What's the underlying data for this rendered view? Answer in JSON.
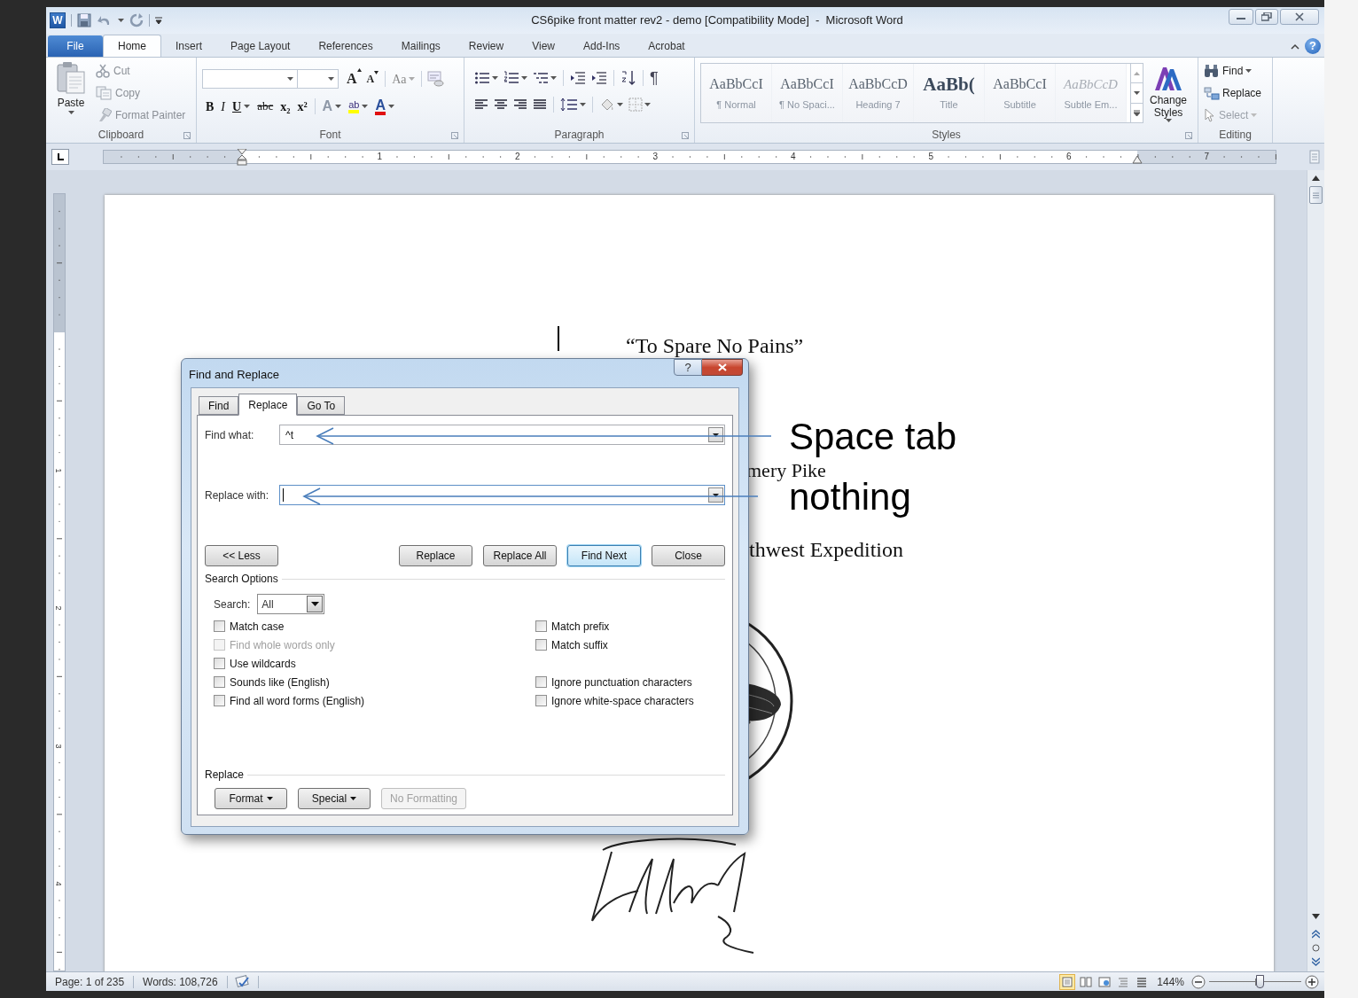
{
  "window": {
    "app_icon": "W",
    "title": "CS6pike front matter rev2 - demo [Compatibility Mode]  -  Microsoft Word",
    "help": "?"
  },
  "tabs": [
    {
      "label": "File",
      "kind": "file",
      "selected": false
    },
    {
      "label": "Home",
      "kind": "tab",
      "selected": true
    },
    {
      "label": "Insert",
      "kind": "tab",
      "selected": false
    },
    {
      "label": "Page Layout",
      "kind": "tab",
      "selected": false
    },
    {
      "label": "References",
      "kind": "tab",
      "selected": false
    },
    {
      "label": "Mailings",
      "kind": "tab",
      "selected": false
    },
    {
      "label": "Review",
      "kind": "tab",
      "selected": false
    },
    {
      "label": "View",
      "kind": "tab",
      "selected": false
    },
    {
      "label": "Add-Ins",
      "kind": "tab",
      "selected": false
    },
    {
      "label": "Acrobat",
      "kind": "tab",
      "selected": false
    }
  ],
  "clipboard": {
    "label": "Clipboard",
    "paste": "Paste",
    "items": [
      {
        "label": "Cut",
        "kind": "cut",
        "disabled": true
      },
      {
        "label": "Copy",
        "kind": "copy",
        "disabled": true
      },
      {
        "label": "Format Painter",
        "kind": "painter",
        "disabled": true
      }
    ]
  },
  "font": {
    "label": "Font",
    "row1": [
      {
        "text": "A",
        "kind": "grow"
      },
      {
        "text": "A",
        "kind": "shrink"
      },
      {
        "text": "Aa",
        "kind": "case",
        "menu": true
      }
    ],
    "row2": [
      {
        "text": "B",
        "kind": "bold",
        "menu": false
      },
      {
        "text": "I",
        "kind": "italic",
        "menu": false
      },
      {
        "text": "U",
        "kind": "underline",
        "menu": true
      },
      {
        "text": "abc",
        "kind": "strike",
        "menu": false
      },
      {
        "text": "x₂",
        "kind": "sub",
        "menu": false
      },
      {
        "text": "x²",
        "kind": "sup",
        "menu": false
      },
      {
        "text": "A",
        "kind": "effects",
        "menu": true
      },
      {
        "text": "ab",
        "kind": "highlight",
        "menu": true
      },
      {
        "text": "A",
        "kind": "color",
        "menu": true
      }
    ]
  },
  "paragraph": {
    "label": "Paragraph",
    "pilcrow": "¶"
  },
  "styles": {
    "label": "Styles",
    "change_styles": "Change Styles",
    "gallery": [
      {
        "preview": "AaBbCcI",
        "name": "¶ Normal",
        "kind": "normal"
      },
      {
        "preview": "AaBbCcI",
        "name": "¶ No Spaci...",
        "kind": "normal"
      },
      {
        "preview": "AaBbCcD",
        "name": "Heading 7",
        "kind": "normal"
      },
      {
        "preview": "AaBb(",
        "name": "Title",
        "kind": "title"
      },
      {
        "preview": "AaBbCcI",
        "name": "Subtitle",
        "kind": "normal"
      },
      {
        "preview": "AaBbCcD",
        "name": "Subtle Em...",
        "kind": "emphasis"
      }
    ]
  },
  "editing": {
    "label": "Editing",
    "items": [
      {
        "label": "Find",
        "kind": "find",
        "menu": true,
        "disabled": false
      },
      {
        "label": "Replace",
        "kind": "replace",
        "menu": false,
        "disabled": false
      },
      {
        "label": "Select",
        "kind": "select",
        "menu": true,
        "disabled": true
      }
    ]
  },
  "ruler": {
    "numbers": [
      "1",
      "2",
      "3",
      "4",
      "5",
      "6",
      "7"
    ]
  },
  "vertical_ruler": {
    "numbers": [
      "1",
      "2",
      "3",
      "4"
    ]
  },
  "page": {
    "title": "“To Spare No Pains”",
    "line_2": "mery Pike",
    "line_3": "thwest Expedition"
  },
  "dialog": {
    "title": "Find and Replace",
    "help": "?",
    "tabs": [
      {
        "label": "Find",
        "selected": false
      },
      {
        "label": "Replace",
        "selected": true
      },
      {
        "label": "Go To",
        "selected": false
      }
    ],
    "find_what": {
      "label": "Find what:",
      "value": "^t"
    },
    "replace_with": {
      "label": "Replace with:",
      "focused": true
    },
    "buttons": [
      {
        "label": "<< Less",
        "kind": "toggle",
        "default": false
      },
      {
        "label": "Replace",
        "kind": "action",
        "default": false
      },
      {
        "label": "Replace All",
        "kind": "action",
        "default": false
      },
      {
        "label": "Find Next",
        "kind": "action",
        "default": true
      },
      {
        "label": "Close",
        "kind": "action",
        "default": false
      }
    ],
    "search_options": {
      "label": "Search Options",
      "search_label": "Search:",
      "search_value": "All",
      "left": [
        {
          "label": "Match case",
          "checked": false,
          "disabled": false
        },
        {
          "label": "Find whole words only",
          "checked": false,
          "disabled": true
        },
        {
          "label": "Use wildcards",
          "checked": false,
          "disabled": false
        },
        {
          "label": "Sounds like (English)",
          "checked": false,
          "disabled": false
        },
        {
          "label": "Find all word forms (English)",
          "checked": false,
          "disabled": false
        }
      ],
      "right_upper": [
        {
          "label": "Match prefix",
          "checked": false,
          "disabled": false
        },
        {
          "label": "Match suffix",
          "checked": false,
          "disabled": false
        }
      ],
      "right_lower": [
        {
          "label": "Ignore punctuation characters",
          "checked": false,
          "disabled": false
        },
        {
          "label": "Ignore white-space characters",
          "checked": false,
          "disabled": false
        }
      ]
    },
    "replace_section": {
      "label": "Replace",
      "buttons": [
        {
          "label": "Format",
          "menu": true,
          "disabled": false
        },
        {
          "label": "Special",
          "menu": true,
          "disabled": false
        },
        {
          "label": "No Formatting",
          "menu": false,
          "disabled": true
        }
      ]
    }
  },
  "annotations": [
    {
      "text": "Space tab"
    },
    {
      "text": "nothing"
    }
  ],
  "status_bar": {
    "page": "Page: 1 of 235",
    "words": "Words: 108,726",
    "zoom": "144%",
    "zoom_slider": {
      "level": 0.55
    },
    "views": [
      {
        "kind": "print",
        "selected": true
      },
      {
        "kind": "reading",
        "selected": false
      },
      {
        "kind": "web",
        "selected": false
      },
      {
        "kind": "outline",
        "selected": false
      },
      {
        "kind": "draft",
        "selected": false
      }
    ]
  }
}
